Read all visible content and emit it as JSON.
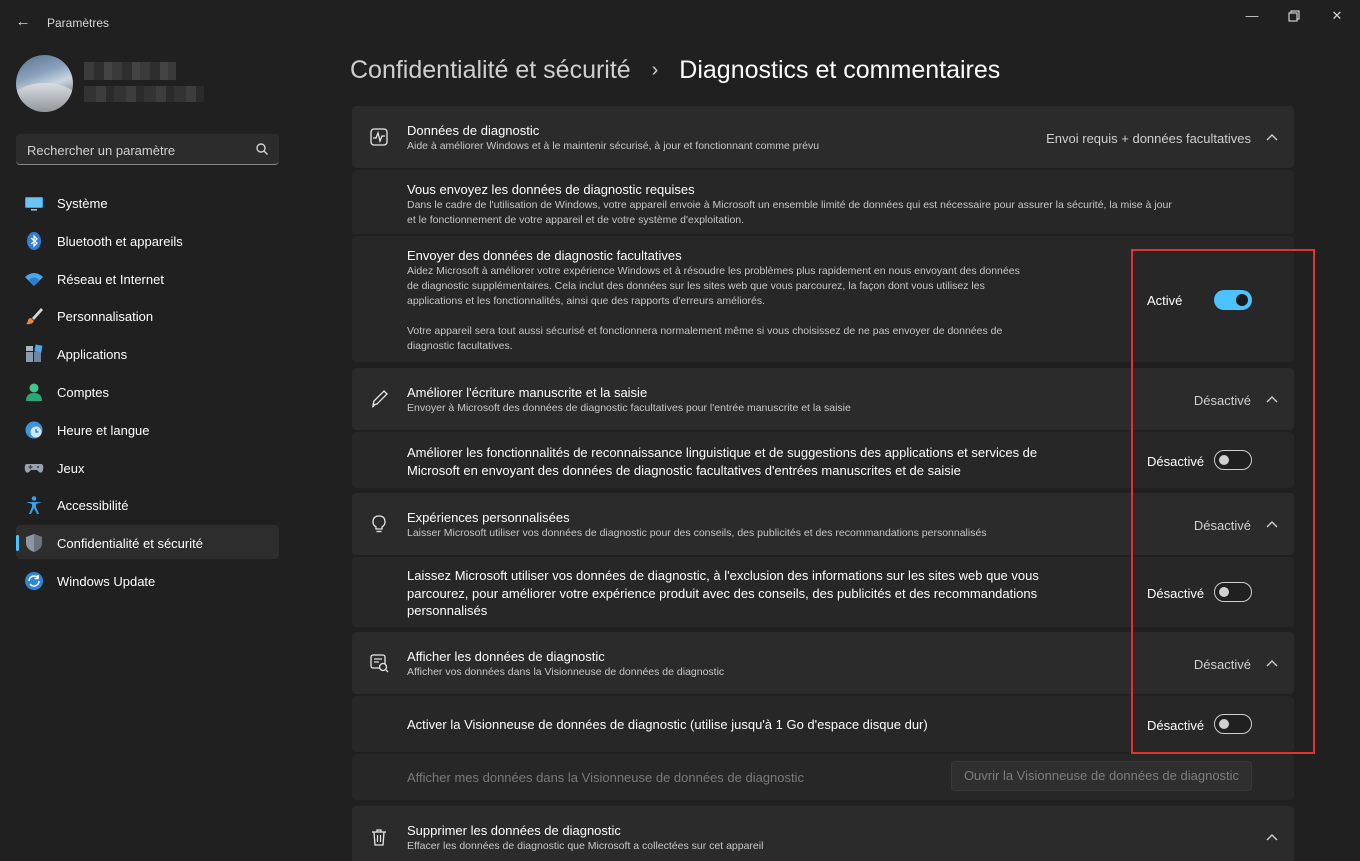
{
  "window": {
    "title": "Paramètres"
  },
  "search": {
    "placeholder": "Rechercher un paramètre"
  },
  "sidebar": {
    "items": [
      {
        "label": "Système",
        "icon": "monitor-icon"
      },
      {
        "label": "Bluetooth et appareils",
        "icon": "bluetooth-icon"
      },
      {
        "label": "Réseau et Internet",
        "icon": "wifi-icon"
      },
      {
        "label": "Personnalisation",
        "icon": "brush-icon"
      },
      {
        "label": "Applications",
        "icon": "apps-icon"
      },
      {
        "label": "Comptes",
        "icon": "person-icon"
      },
      {
        "label": "Heure et langue",
        "icon": "clock-globe-icon"
      },
      {
        "label": "Jeux",
        "icon": "gamepad-icon"
      },
      {
        "label": "Accessibilité",
        "icon": "accessibility-icon"
      },
      {
        "label": "Confidentialité et sécurité",
        "icon": "shield-icon",
        "active": true
      },
      {
        "label": "Windows Update",
        "icon": "sync-icon"
      }
    ]
  },
  "breadcrumb": {
    "parent": "Confidentialité et sécurité",
    "separator": "›",
    "current": "Diagnostics et commentaires"
  },
  "sections": {
    "diag": {
      "title": "Données de diagnostic",
      "desc": "Aide à améliorer Windows et à le maintenir sécurisé, à jour et fonctionnant comme prévu",
      "value": "Envoi requis + données facultatives",
      "required": {
        "title": "Vous envoyez les données de diagnostic requises",
        "line1": "Dans le cadre de l'utilisation de Windows, votre appareil envoie à Microsoft un ensemble limité de données qui est nécessaire pour assurer la sécurité, la mise à jour",
        "line2": "et le fonctionnement de votre appareil et de votre système d'exploitation."
      },
      "optional": {
        "title": "Envoyer des données de diagnostic facultatives",
        "line1": "Aidez Microsoft à améliorer votre expérience Windows et à résoudre les problèmes plus rapidement en nous envoyant des données",
        "line2": "de diagnostic supplémentaires. Cela inclut des données sur les sites web que vous parcourez, la façon dont vous utilisez les",
        "line3": "applications et les fonctionnalités, ainsi que des rapports d'erreurs améliorés.",
        "line4": "Votre appareil sera tout aussi sécurisé et fonctionnera normalement même si vous choisissez de ne pas envoyer de données de",
        "line5": "diagnostic facultatives.",
        "toggle_label": "Activé",
        "toggle_on": true
      }
    },
    "handwriting": {
      "title": "Améliorer l'écriture manuscrite et la saisie",
      "desc": "Envoyer à Microsoft des données de diagnostic facultatives pour l'entrée manuscrite et la saisie",
      "value": "Désactivé",
      "sub": {
        "line1": "Améliorer les fonctionnalités de reconnaissance linguistique et de suggestions des applications et services de",
        "line2": "Microsoft en envoyant des données de diagnostic facultatives d'entrées manuscrites et de saisie",
        "toggle_label": "Désactivé",
        "toggle_on": false
      }
    },
    "tailored": {
      "title": "Expériences personnalisées",
      "desc": "Laisser Microsoft utiliser vos données de diagnostic pour des conseils, des publicités et des recommandations personnalisés",
      "value": "Désactivé",
      "sub": {
        "line1": "Laissez Microsoft utiliser vos données de diagnostic, à l'exclusion des informations sur les sites web que vous",
        "line2": "parcourez, pour améliorer votre expérience produit avec des conseils, des publicités et des recommandations",
        "line3": "personnalisés",
        "toggle_label": "Désactivé",
        "toggle_on": false
      }
    },
    "viewer": {
      "title": "Afficher les données de diagnostic",
      "desc": "Afficher vos données dans la Visionneuse de données de diagnostic",
      "value": "Désactivé",
      "sub": {
        "title": "Activer la Visionneuse de données de diagnostic (utilise jusqu'à 1 Go d'espace disque dur)",
        "toggle_label": "Désactivé",
        "toggle_on": false
      },
      "open_row": {
        "text": "Afficher mes données dans la Visionneuse de données de diagnostic",
        "button": "Ouvrir la Visionneuse de données de diagnostic"
      }
    },
    "delete": {
      "title": "Supprimer les données de diagnostic",
      "desc": "Effacer les données de diagnostic que Microsoft a collectées sur cet appareil"
    }
  },
  "colors": {
    "accent": "#4cc2ff",
    "highlight": "#e0332e",
    "background": "#202020",
    "card": "#2b2b2b"
  }
}
